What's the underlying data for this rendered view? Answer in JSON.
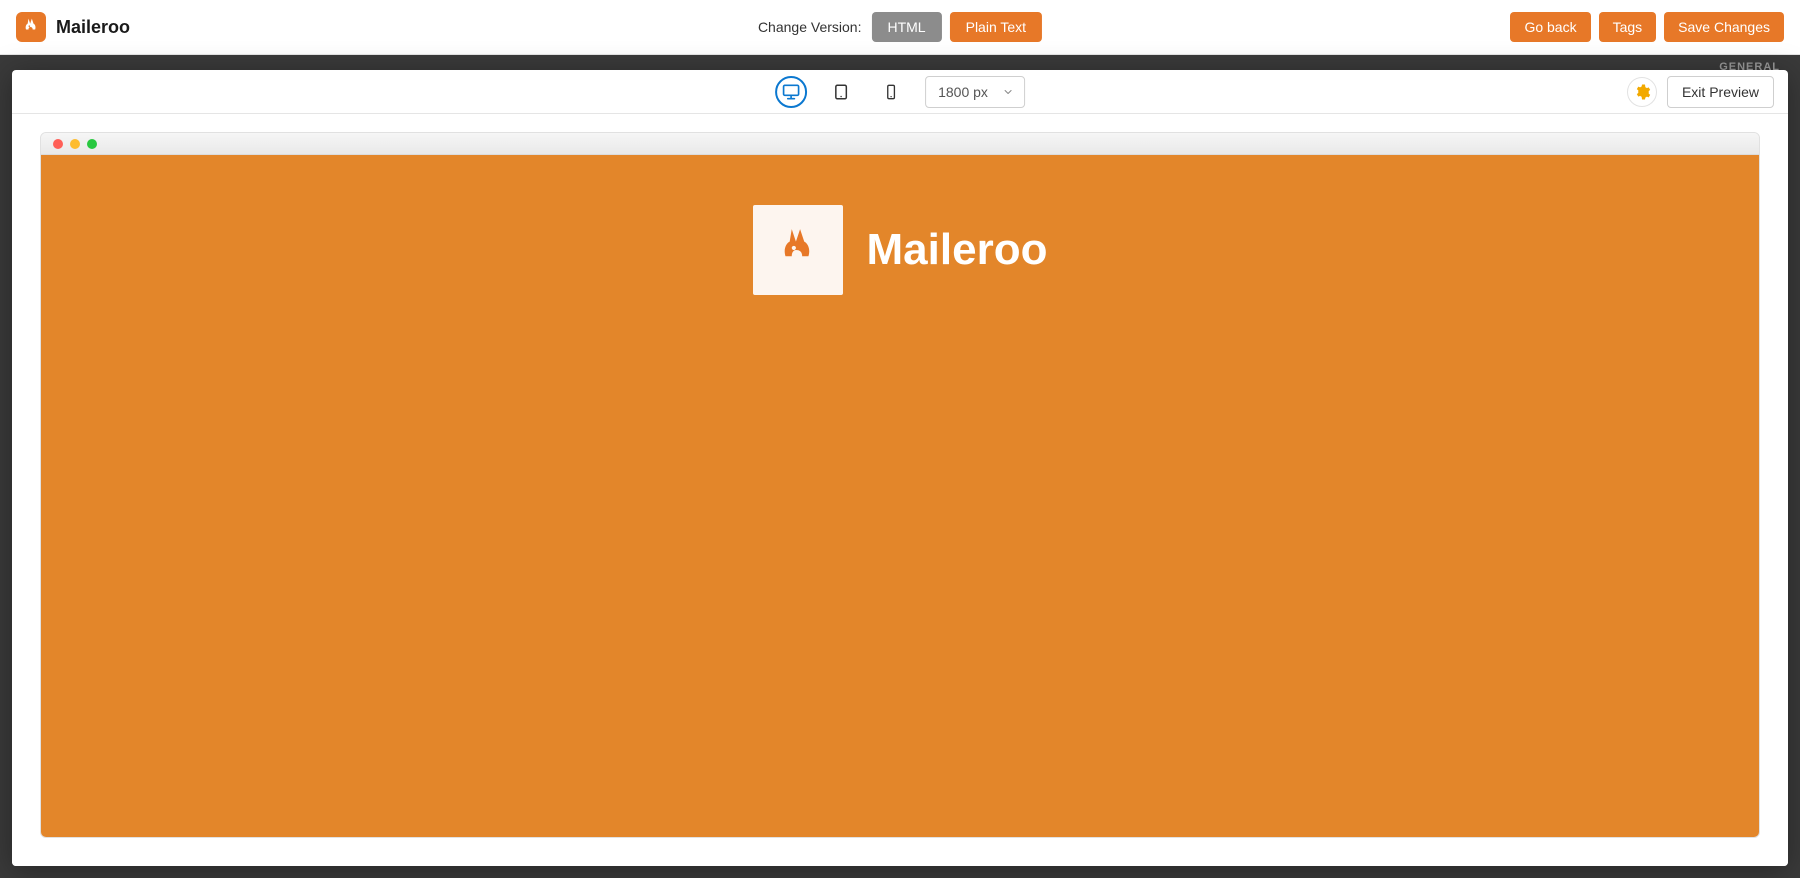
{
  "brand": {
    "name": "Maileroo"
  },
  "header": {
    "change_version_label": "Change Version:",
    "html_label": "HTML",
    "plaintext_label": "Plain Text",
    "go_back_label": "Go back",
    "tags_label": "Tags",
    "save_label": "Save Changes"
  },
  "side_panel": {
    "section_title": "GENERAL"
  },
  "preview": {
    "viewports": {
      "active": "desktop",
      "width_display": "1800 px"
    },
    "exit_label": "Exit Preview"
  },
  "email_content": {
    "hero_text": "Maileroo"
  },
  "colors": {
    "accent": "#e77828",
    "canvas": "#e3862a",
    "toolbar_inactive": "#8c8c8c",
    "link_blue": "#0b78d0"
  }
}
